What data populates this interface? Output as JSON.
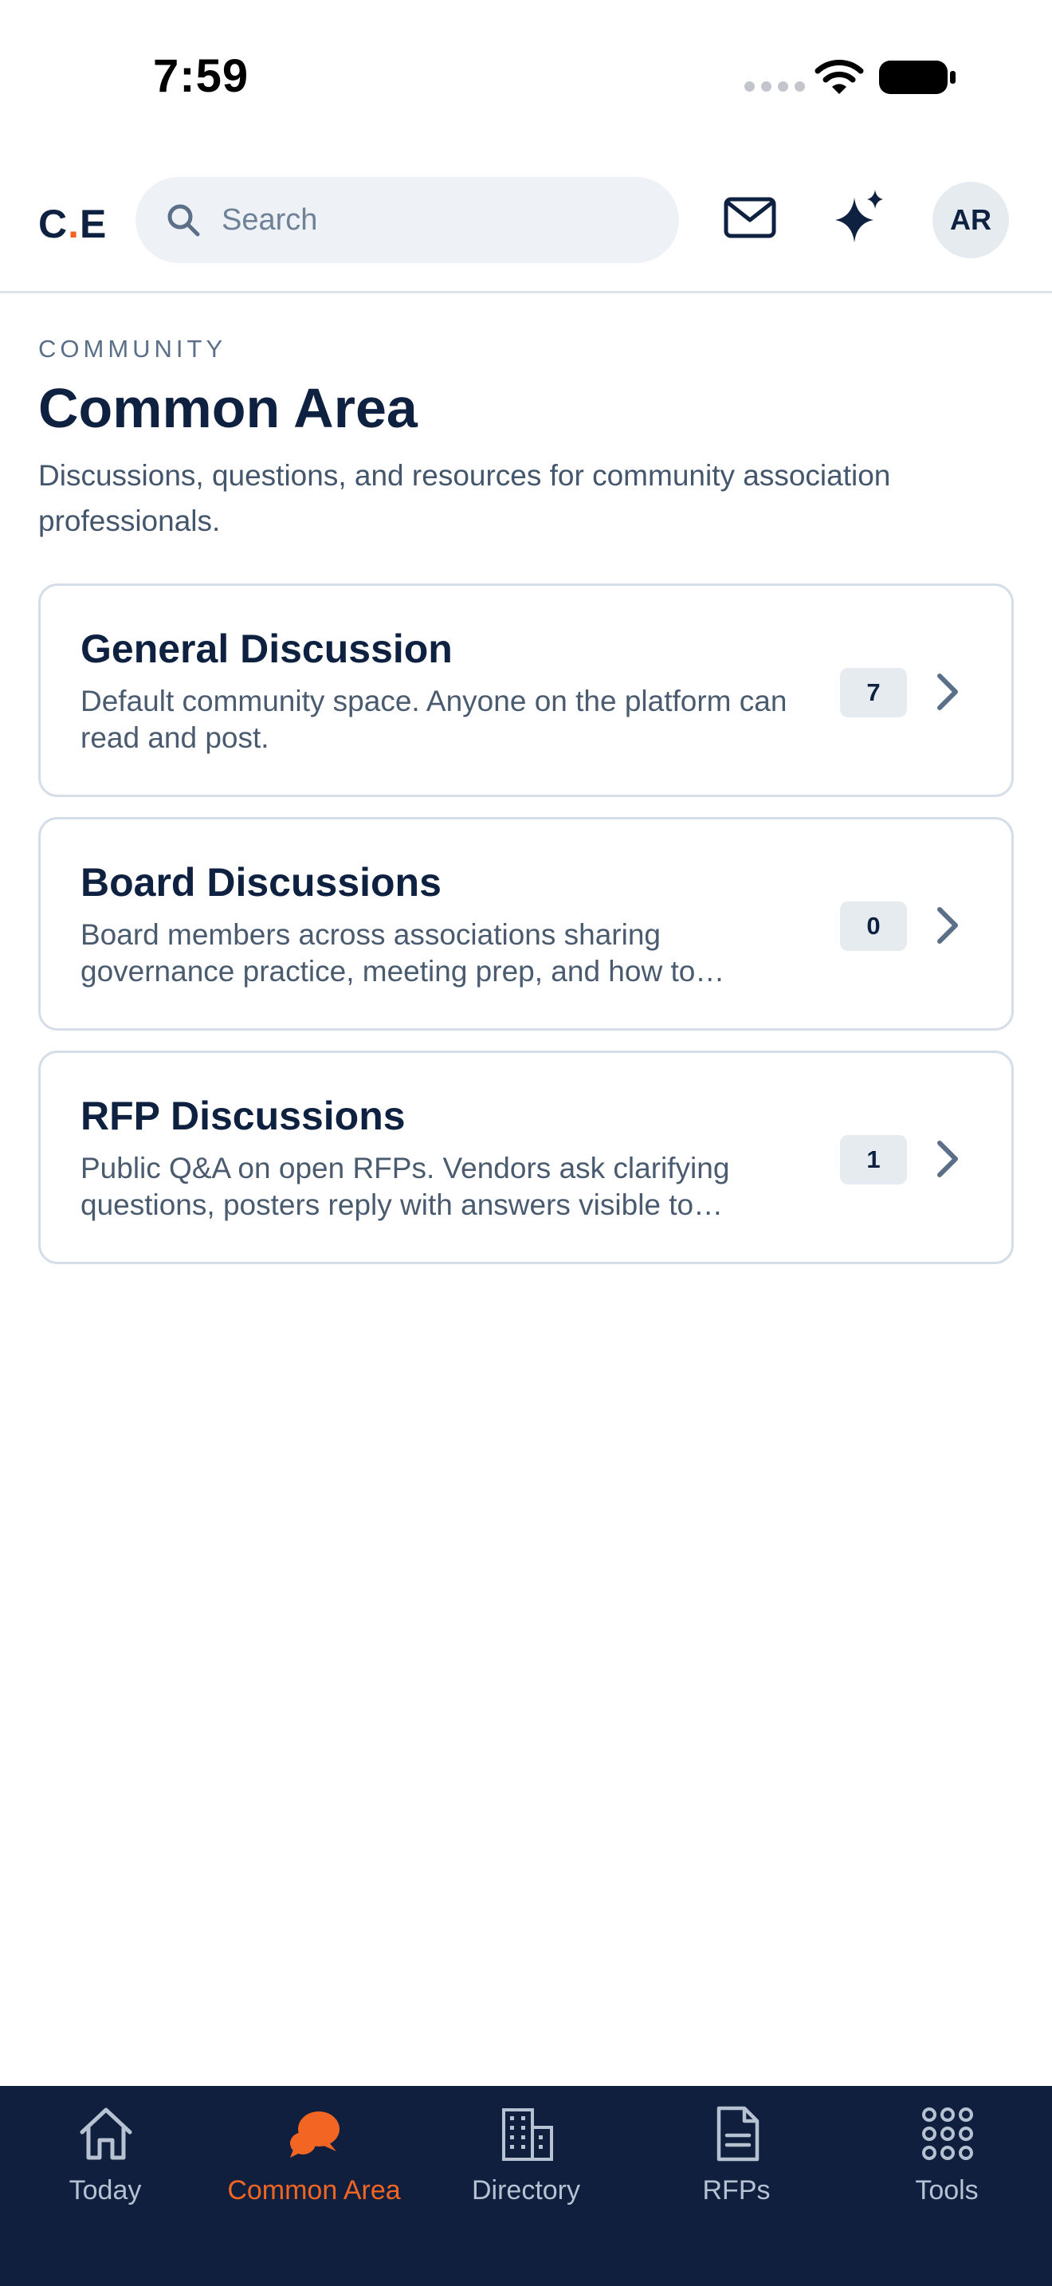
{
  "status_bar": {
    "time": "7:59"
  },
  "header": {
    "logo_left": "C",
    "logo_dot": ".",
    "logo_right": "E",
    "search_placeholder": "Search",
    "avatar_initials": "AR"
  },
  "main": {
    "eyebrow": "COMMUNITY",
    "title": "Common Area",
    "description": "Discussions, questions, and resources for community association professionals.",
    "categories": [
      {
        "title": "General Discussion",
        "description": "Default community space. Anyone on the platform can read and post.",
        "count": "7"
      },
      {
        "title": "Board Discussions",
        "description": "Board members across associations sharing governance practice, meeting prep, and how to…",
        "count": "0"
      },
      {
        "title": "RFP Discussions",
        "description": "Public Q&A on open RFPs. Vendors ask clarifying questions, posters reply with answers visible to…",
        "count": "1"
      }
    ]
  },
  "tab_bar": {
    "active": "Common Area",
    "tabs": [
      {
        "label": "Today",
        "icon": "home-icon"
      },
      {
        "label": "Common Area",
        "icon": "chat-bubbles-icon"
      },
      {
        "label": "Directory",
        "icon": "building-icon"
      },
      {
        "label": "RFPs",
        "icon": "document-icon"
      },
      {
        "label": "Tools",
        "icon": "grid-icon"
      }
    ]
  },
  "colors": {
    "brand_navy": "#0f1f3d",
    "accent_orange": "#f26522",
    "muted_text": "#5b7088"
  }
}
